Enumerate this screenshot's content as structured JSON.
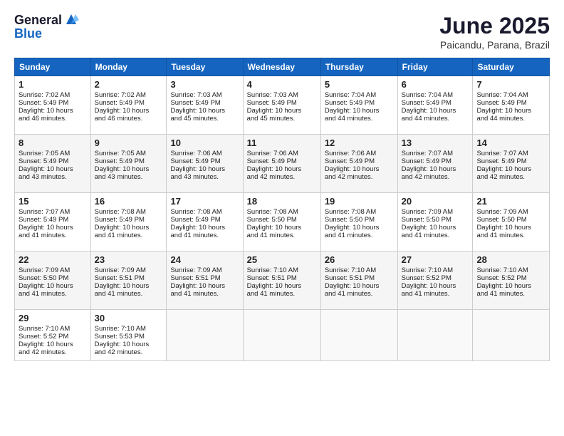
{
  "logo": {
    "line1": "General",
    "line2": "Blue"
  },
  "title": "June 2025",
  "subtitle": "Paicandu, Parana, Brazil",
  "days_of_week": [
    "Sunday",
    "Monday",
    "Tuesday",
    "Wednesday",
    "Thursday",
    "Friday",
    "Saturday"
  ],
  "weeks": [
    [
      {
        "day": "1",
        "sunrise": "7:02 AM",
        "sunset": "5:49 PM",
        "daylight": "10 hours and 46 minutes."
      },
      {
        "day": "2",
        "sunrise": "7:02 AM",
        "sunset": "5:49 PM",
        "daylight": "10 hours and 46 minutes."
      },
      {
        "day": "3",
        "sunrise": "7:03 AM",
        "sunset": "5:49 PM",
        "daylight": "10 hours and 45 minutes."
      },
      {
        "day": "4",
        "sunrise": "7:03 AM",
        "sunset": "5:49 PM",
        "daylight": "10 hours and 45 minutes."
      },
      {
        "day": "5",
        "sunrise": "7:04 AM",
        "sunset": "5:49 PM",
        "daylight": "10 hours and 44 minutes."
      },
      {
        "day": "6",
        "sunrise": "7:04 AM",
        "sunset": "5:49 PM",
        "daylight": "10 hours and 44 minutes."
      },
      {
        "day": "7",
        "sunrise": "7:04 AM",
        "sunset": "5:49 PM",
        "daylight": "10 hours and 44 minutes."
      }
    ],
    [
      {
        "day": "8",
        "sunrise": "7:05 AM",
        "sunset": "5:49 PM",
        "daylight": "10 hours and 43 minutes."
      },
      {
        "day": "9",
        "sunrise": "7:05 AM",
        "sunset": "5:49 PM",
        "daylight": "10 hours and 43 minutes."
      },
      {
        "day": "10",
        "sunrise": "7:06 AM",
        "sunset": "5:49 PM",
        "daylight": "10 hours and 43 minutes."
      },
      {
        "day": "11",
        "sunrise": "7:06 AM",
        "sunset": "5:49 PM",
        "daylight": "10 hours and 42 minutes."
      },
      {
        "day": "12",
        "sunrise": "7:06 AM",
        "sunset": "5:49 PM",
        "daylight": "10 hours and 42 minutes."
      },
      {
        "day": "13",
        "sunrise": "7:07 AM",
        "sunset": "5:49 PM",
        "daylight": "10 hours and 42 minutes."
      },
      {
        "day": "14",
        "sunrise": "7:07 AM",
        "sunset": "5:49 PM",
        "daylight": "10 hours and 42 minutes."
      }
    ],
    [
      {
        "day": "15",
        "sunrise": "7:07 AM",
        "sunset": "5:49 PM",
        "daylight": "10 hours and 41 minutes."
      },
      {
        "day": "16",
        "sunrise": "7:08 AM",
        "sunset": "5:49 PM",
        "daylight": "10 hours and 41 minutes."
      },
      {
        "day": "17",
        "sunrise": "7:08 AM",
        "sunset": "5:49 PM",
        "daylight": "10 hours and 41 minutes."
      },
      {
        "day": "18",
        "sunrise": "7:08 AM",
        "sunset": "5:50 PM",
        "daylight": "10 hours and 41 minutes."
      },
      {
        "day": "19",
        "sunrise": "7:08 AM",
        "sunset": "5:50 PM",
        "daylight": "10 hours and 41 minutes."
      },
      {
        "day": "20",
        "sunrise": "7:09 AM",
        "sunset": "5:50 PM",
        "daylight": "10 hours and 41 minutes."
      },
      {
        "day": "21",
        "sunrise": "7:09 AM",
        "sunset": "5:50 PM",
        "daylight": "10 hours and 41 minutes."
      }
    ],
    [
      {
        "day": "22",
        "sunrise": "7:09 AM",
        "sunset": "5:50 PM",
        "daylight": "10 hours and 41 minutes."
      },
      {
        "day": "23",
        "sunrise": "7:09 AM",
        "sunset": "5:51 PM",
        "daylight": "10 hours and 41 minutes."
      },
      {
        "day": "24",
        "sunrise": "7:09 AM",
        "sunset": "5:51 PM",
        "daylight": "10 hours and 41 minutes."
      },
      {
        "day": "25",
        "sunrise": "7:10 AM",
        "sunset": "5:51 PM",
        "daylight": "10 hours and 41 minutes."
      },
      {
        "day": "26",
        "sunrise": "7:10 AM",
        "sunset": "5:51 PM",
        "daylight": "10 hours and 41 minutes."
      },
      {
        "day": "27",
        "sunrise": "7:10 AM",
        "sunset": "5:52 PM",
        "daylight": "10 hours and 41 minutes."
      },
      {
        "day": "28",
        "sunrise": "7:10 AM",
        "sunset": "5:52 PM",
        "daylight": "10 hours and 41 minutes."
      }
    ],
    [
      {
        "day": "29",
        "sunrise": "7:10 AM",
        "sunset": "5:52 PM",
        "daylight": "10 hours and 42 minutes."
      },
      {
        "day": "30",
        "sunrise": "7:10 AM",
        "sunset": "5:53 PM",
        "daylight": "10 hours and 42 minutes."
      },
      null,
      null,
      null,
      null,
      null
    ]
  ],
  "labels": {
    "sunrise": "Sunrise:",
    "sunset": "Sunset:",
    "daylight": "Daylight:"
  }
}
